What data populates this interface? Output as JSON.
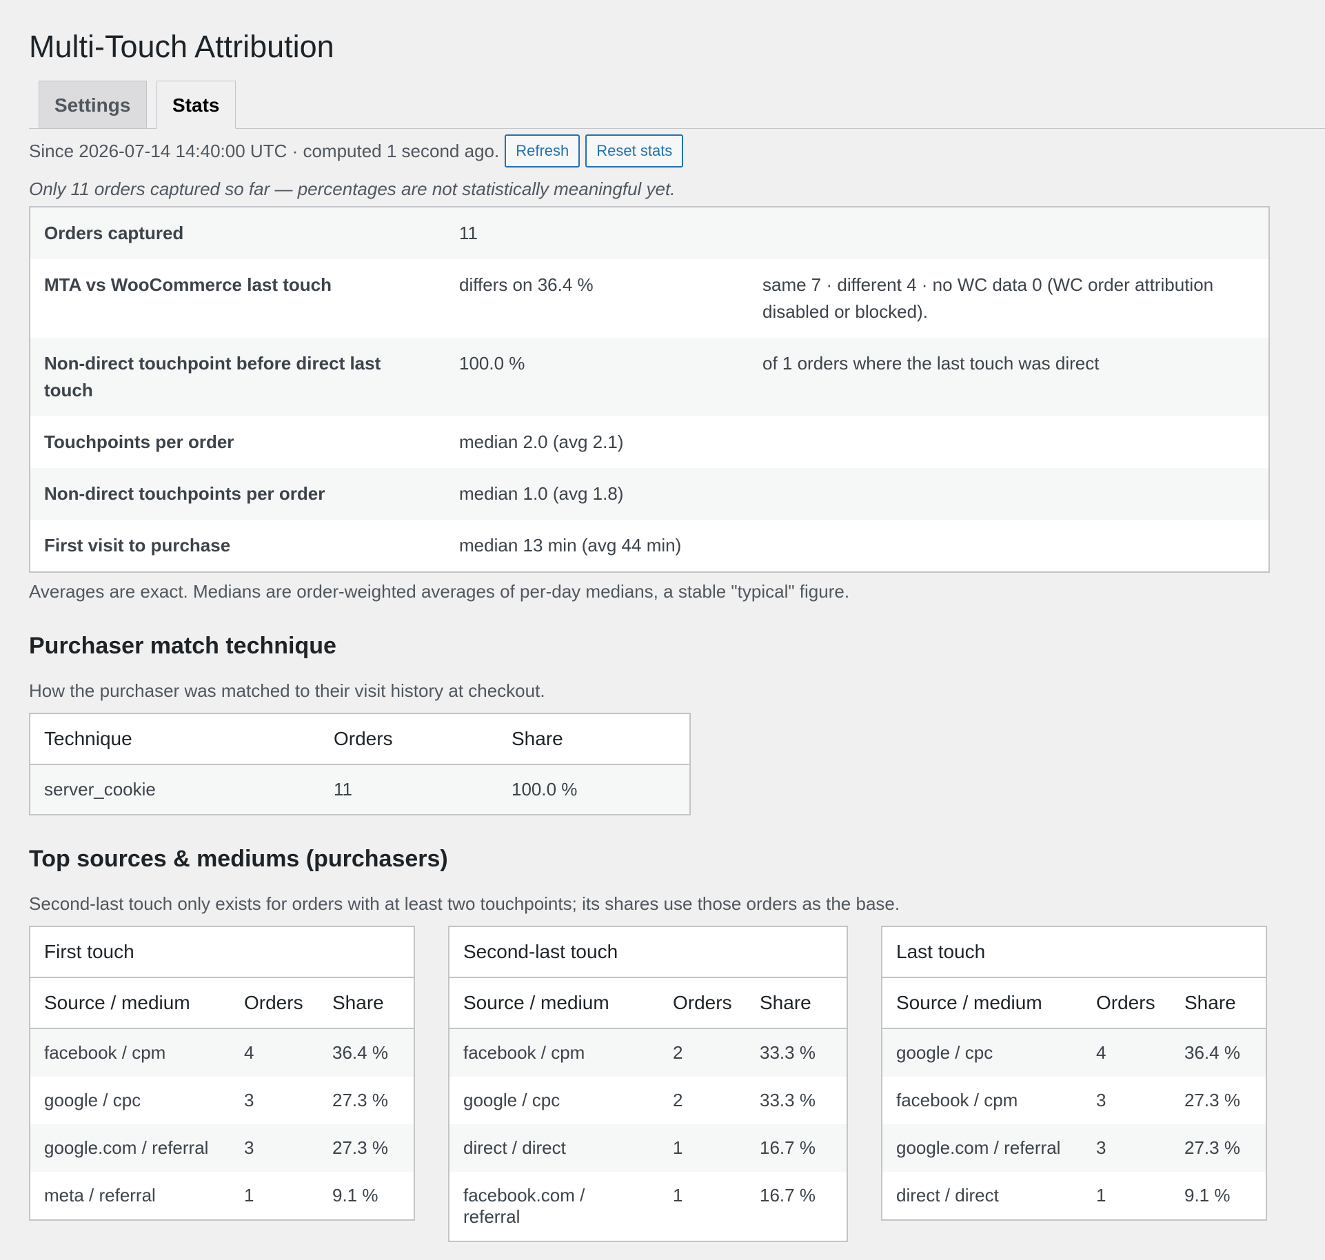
{
  "page_title": "Multi-Touch Attribution",
  "tabs": [
    {
      "label": "Settings",
      "active": false
    },
    {
      "label": "Stats",
      "active": true
    }
  ],
  "status_line": "Since 2026-07-14 14:40:00 UTC · computed 1 second ago.",
  "buttons": {
    "refresh": "Refresh",
    "reset": "Reset stats"
  },
  "warning_note": "Only 11 orders captured so far — percentages are not statistically meaningful yet.",
  "summary": [
    {
      "label": "Orders captured",
      "value": "11",
      "extra": ""
    },
    {
      "label": "MTA vs WooCommerce last touch",
      "value": "differs on 36.4 %",
      "extra": "same 7 · different 4 · no WC data 0 (WC order attribution disabled or blocked)."
    },
    {
      "label": "Non-direct touchpoint before direct last touch",
      "value": "100.0 %",
      "extra": "of 1 orders where the last touch was direct"
    },
    {
      "label": "Touchpoints per order",
      "value": "median 2.0 (avg 2.1)",
      "extra": ""
    },
    {
      "label": "Non-direct touchpoints per order",
      "value": "median 1.0 (avg 1.8)",
      "extra": ""
    },
    {
      "label": "First visit to purchase",
      "value": "median 13 min (avg 44 min)",
      "extra": ""
    }
  ],
  "summary_footnote": "Averages are exact. Medians are order-weighted averages of per-day medians, a stable \"typical\" figure.",
  "match_section": {
    "heading": "Purchaser match technique",
    "description": "How the purchaser was matched to their visit history at checkout.",
    "headers": [
      "Technique",
      "Orders",
      "Share"
    ],
    "rows": [
      [
        "server_cookie",
        "11",
        "100.0 %"
      ]
    ]
  },
  "sources_section": {
    "heading": "Top sources & mediums (purchasers)",
    "description": "Second-last touch only exists for orders with at least two touchpoints; its shares use those orders as the base.",
    "headers": [
      "Source / medium",
      "Orders",
      "Share"
    ],
    "tables": [
      {
        "caption": "First touch",
        "rows": [
          [
            "facebook / cpm",
            "4",
            "36.4 %"
          ],
          [
            "google / cpc",
            "3",
            "27.3 %"
          ],
          [
            "google.com / referral",
            "3",
            "27.3 %"
          ],
          [
            "meta / referral",
            "1",
            "9.1 %"
          ]
        ]
      },
      {
        "caption": "Second-last touch",
        "rows": [
          [
            "facebook / cpm",
            "2",
            "33.3 %"
          ],
          [
            "google / cpc",
            "2",
            "33.3 %"
          ],
          [
            "direct / direct",
            "1",
            "16.7 %"
          ],
          [
            "facebook.com / referral",
            "1",
            "16.7 %"
          ]
        ]
      },
      {
        "caption": "Last touch",
        "rows": [
          [
            "google / cpc",
            "4",
            "36.4 %"
          ],
          [
            "facebook / cpm",
            "3",
            "27.3 %"
          ],
          [
            "google.com / referral",
            "3",
            "27.3 %"
          ],
          [
            "direct / direct",
            "1",
            "9.1 %"
          ]
        ]
      }
    ]
  }
}
